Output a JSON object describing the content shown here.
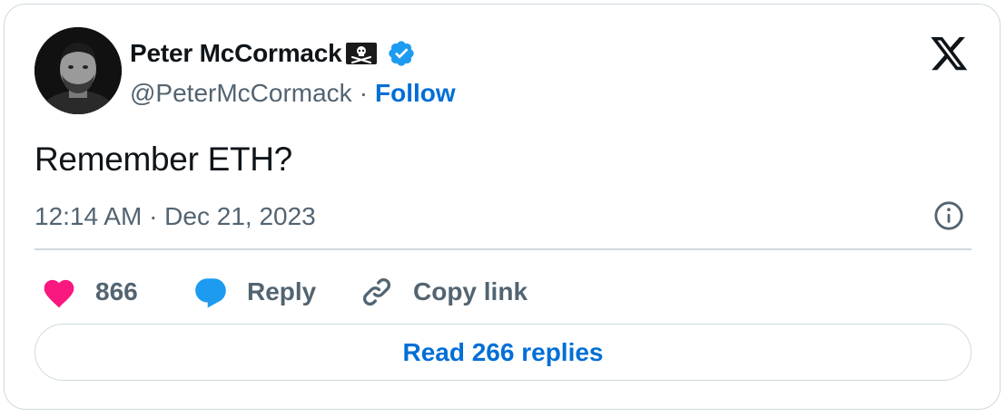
{
  "author": {
    "display_name": "Peter McCormack",
    "handle": "@PeterMcCormack",
    "separator": "·",
    "follow_label": "Follow",
    "name_emoji": "pirate-flag-icon",
    "verified_badge": "verified-badge-icon"
  },
  "tweet": {
    "text": "Remember ETH?",
    "timestamp": "12:14 AM · Dec 21, 2023"
  },
  "actions": {
    "like_count": "866",
    "reply_label": "Reply",
    "copy_link_label": "Copy link"
  },
  "footer": {
    "read_replies_label": "Read 266 replies"
  },
  "colors": {
    "link_blue": "#006fd6",
    "heart_pink": "#f91880",
    "reply_blue": "#1d9bf0",
    "text_primary": "#0f1419",
    "text_secondary": "#536471",
    "border": "#cfd9de",
    "verified_blue": "#1d9bf0"
  }
}
